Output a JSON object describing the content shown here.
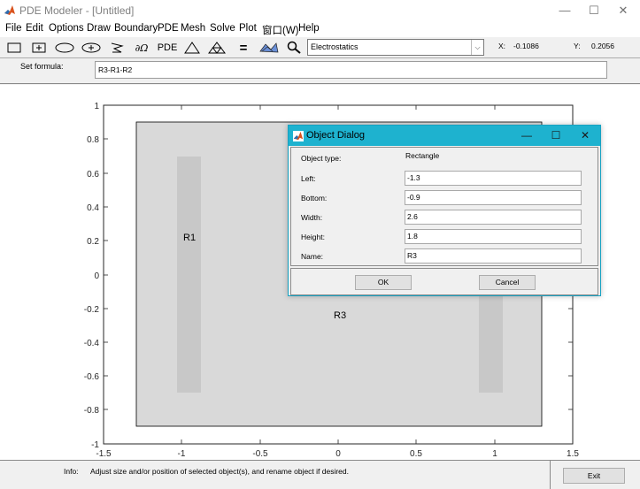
{
  "window": {
    "title": "PDE Modeler - [Untitled]",
    "controls": {
      "minimize": "—",
      "maximize": "☐",
      "close": "✕"
    }
  },
  "menu": [
    "File",
    "Edit",
    "Options",
    "Draw",
    "Boundary",
    "PDE",
    "Mesh",
    "Solve",
    "Plot",
    "窗口(W)",
    "Help"
  ],
  "toolbar": {
    "buttons": [
      {
        "name": "draw-rectangle-icon"
      },
      {
        "name": "draw-centered-rectangle-icon"
      },
      {
        "name": "draw-ellipse-icon"
      },
      {
        "name": "draw-centered-ellipse-icon"
      },
      {
        "name": "draw-polygon-icon"
      },
      {
        "name": "boundary-mode-icon",
        "label": "∂Ω"
      },
      {
        "name": "pde-specification-button",
        "label": "PDE"
      },
      {
        "name": "initialize-mesh-icon"
      },
      {
        "name": "refine-mesh-icon"
      },
      {
        "name": "solve-pde-icon",
        "label": "="
      },
      {
        "name": "plot-solution-icon"
      },
      {
        "name": "zoom-icon"
      }
    ],
    "application_mode": "Electrostatics",
    "x_label": "X:",
    "x_value": "-0.1086",
    "y_label": "Y:",
    "y_value": "0.2056"
  },
  "formula": {
    "label": "Set formula:",
    "value": "R3-R1-R2"
  },
  "plot": {
    "x_ticks": [
      "-1.5",
      "-1",
      "-0.5",
      "0",
      "0.5",
      "1",
      "1.5"
    ],
    "y_ticks": [
      "1",
      "0.8",
      "0.6",
      "0.4",
      "0.2",
      "0",
      "-0.2",
      "-0.4",
      "-0.6",
      "-0.8",
      "-1"
    ],
    "labels": {
      "r1": "R1",
      "r3": "R3"
    },
    "colors": {
      "outer_rect": "#d9d9d9",
      "inner_rect": "#c8c8c8"
    }
  },
  "dialog": {
    "title": "Object Dialog",
    "object_type_label": "Object type:",
    "object_type_value": "Rectangle",
    "left_label": "Left:",
    "left_value": "-1.3",
    "bottom_label": "Bottom:",
    "bottom_value": "-0.9",
    "width_label": "Width:",
    "width_value": "2.6",
    "height_label": "Height:",
    "height_value": "1.8",
    "name_label": "Name:",
    "name_value": "R3",
    "ok_label": "OK",
    "cancel_label": "Cancel"
  },
  "status": {
    "info_label": "Info:",
    "info_text": "Adjust size and/or position of selected object(s), and rename object if desired.",
    "exit_label": "Exit"
  },
  "colors": {
    "dialog_titlebar": "#1eb2cf",
    "dialog_border": "#17a2c2"
  }
}
